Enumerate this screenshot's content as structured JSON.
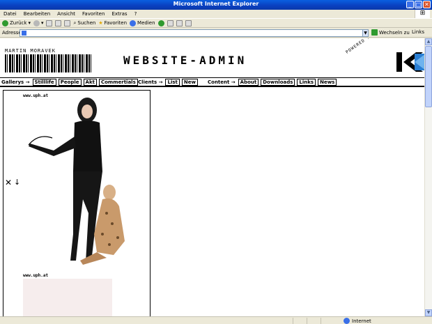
{
  "window": {
    "title": "Microsoft Internet Explorer",
    "minimize": "_",
    "maximize": "□",
    "close": "✕"
  },
  "menu": [
    "Datei",
    "Bearbeiten",
    "Ansicht",
    "Favoriten",
    "Extras",
    "?"
  ],
  "toolbar": {
    "back": "Zurück",
    "search": "Suchen",
    "favorites": "Favoriten",
    "media": "Medien"
  },
  "address": {
    "label": "Adresse",
    "value": "",
    "go": "Wechseln zu",
    "links": "Links"
  },
  "status": {
    "zone": "Internet"
  },
  "page": {
    "brand_name": "MARTIN MORAVEK",
    "site_title": "WEBSITE-ADMIN",
    "powered_by": "POWERED BY",
    "nav": {
      "gallerys_label": "Gallerys →",
      "gallerys": [
        "Stilllife",
        "People",
        "Akt",
        "Commertials"
      ],
      "clients_label": "Clients →",
      "clients": [
        "List",
        "New"
      ],
      "content_label": "Content →",
      "content": [
        "About",
        "Downloads",
        "Links",
        "News"
      ]
    },
    "gallery": {
      "credit1": "www.uph.at",
      "credit2": "www.uph.at",
      "delete_icon": "✕",
      "move_icon": "↓"
    }
  }
}
